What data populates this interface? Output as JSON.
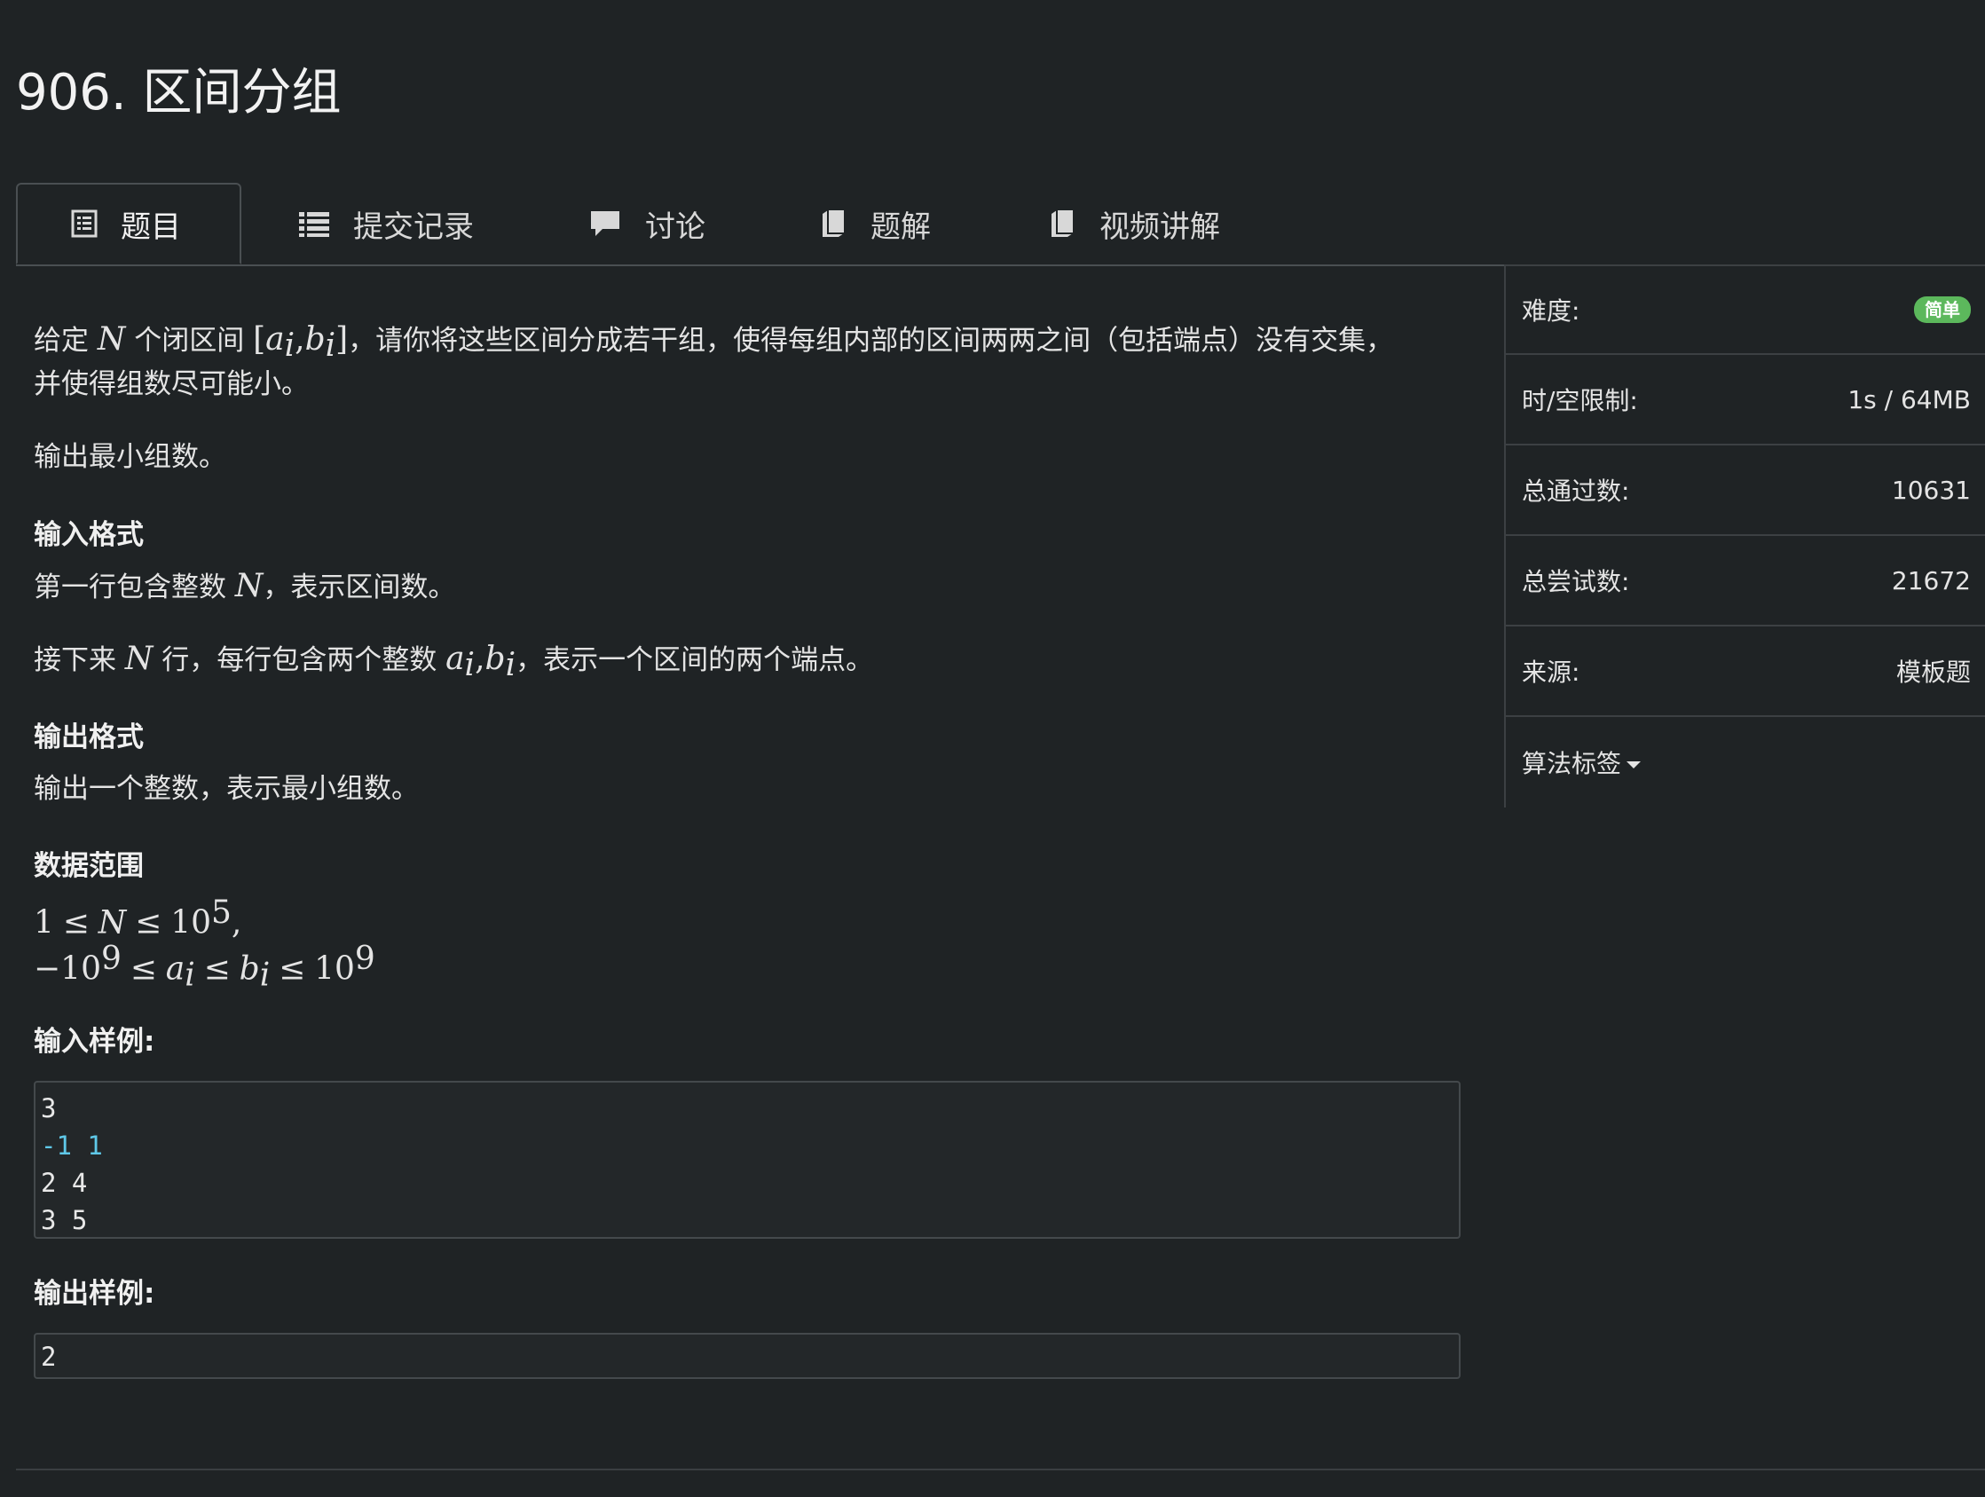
{
  "problem": {
    "title": "906. 区间分组"
  },
  "tabs": [
    {
      "label": "题目",
      "icon": "document-icon",
      "active": true
    },
    {
      "label": "提交记录",
      "icon": "list-icon",
      "active": false
    },
    {
      "label": "讨论",
      "icon": "comment-icon",
      "active": false
    },
    {
      "label": "题解",
      "icon": "book-icon",
      "active": false
    },
    {
      "label": "视频讲解",
      "icon": "book-icon",
      "active": false
    }
  ],
  "statement": {
    "p1_a": "给定",
    "p1_var_n": "N",
    "p1_b": "个闭区间",
    "p1_interval_open": "[",
    "p1_var_a": "a",
    "p1_sub_i": "i",
    "p1_comma": ",",
    "p1_var_b": "b",
    "p1_interval_close": "]",
    "p1_c": "，请你将这些区间分成若干组，使得每组内部的区间两两之间（包括端点）没有交集，",
    "p1_line2": "并使得组数尽可能小。",
    "p2": "输出最小组数。"
  },
  "input_format": {
    "heading": "输入格式",
    "line1_a": "第一行包含整数",
    "line1_var": "N",
    "line1_b": "，表示区间数。",
    "line2_a": "接下来",
    "line2_var": "N",
    "line2_b": "行，每行包含两个整数",
    "line2_c": "，表示一个区间的两个端点。"
  },
  "output_format": {
    "heading": "输出格式",
    "line1": "输出一个整数，表示最小组数。"
  },
  "data_range": {
    "heading": "数据范围",
    "r1_one": "1",
    "r1_le": "≤",
    "r1_n": "N",
    "r1_ten": "10",
    "r1_exp": "5",
    "r1_end": ",",
    "r2_neg": "−10",
    "r2_exp": "9",
    "r2_le": "≤",
    "r2_ten": "10",
    "r2_exp2": "9"
  },
  "sample_input": {
    "heading": "输入样例:",
    "lines": [
      "3",
      "-1 1",
      "2 4",
      "3 5"
    ]
  },
  "sample_output": {
    "heading": "输出样例:",
    "lines": [
      "2"
    ]
  },
  "sidebar": {
    "difficulty_label": "难度:",
    "difficulty_value": "简单",
    "limit_label": "时/空限制:",
    "limit_value": "1s / 64MB",
    "passed_label": "总通过数:",
    "passed_value": "10631",
    "tried_label": "总尝试数:",
    "tried_value": "21672",
    "source_label": "来源:",
    "source_value": "模板题",
    "tags_label": "算法标签"
  },
  "colors": {
    "background": "#1f2325",
    "badge_green": "#5cb85c",
    "code_number": "#5fc8e8"
  }
}
